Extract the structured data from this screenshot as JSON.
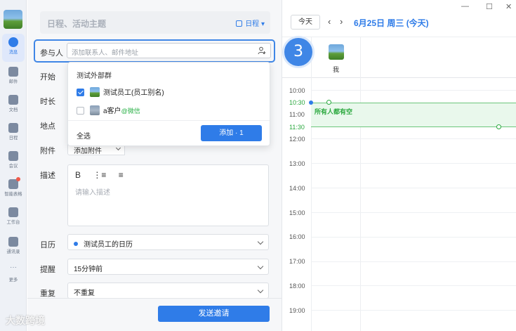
{
  "rail": {
    "items": [
      {
        "label": "消息",
        "icon": "chat-icon"
      },
      {
        "label": "邮件",
        "icon": "mail-icon"
      },
      {
        "label": "文档",
        "icon": "doc-icon"
      },
      {
        "label": "日程",
        "icon": "calendar-icon"
      },
      {
        "label": "会议",
        "icon": "meeting-icon"
      },
      {
        "label": "智能表格",
        "icon": "smart-sheet-icon"
      },
      {
        "label": "工作台",
        "icon": "workbench-icon"
      },
      {
        "label": "通讯录",
        "icon": "contacts-icon"
      },
      {
        "label": "更多",
        "icon": "more-icon"
      }
    ]
  },
  "form": {
    "title_placeholder": "日程、活动主题",
    "calendar_tag": "日程",
    "attendees_label": "参与人",
    "attendees_placeholder": "添加联系人、邮件地址",
    "start_label": "开始",
    "duration_label": "时长",
    "location_label": "地点",
    "attachment_label": "附件",
    "attachment_button": "添加附件",
    "description_label": "描述",
    "description_tools": [
      "B",
      "⋮≡",
      "≡"
    ],
    "description_placeholder": "请输入描述",
    "calendar_label": "日历",
    "calendar_value": "测试员工的日历",
    "reminder_label": "提醒",
    "reminder_value": "15分钟前",
    "repeat_label": "重复",
    "repeat_value": "不重复",
    "send_button": "发送邀请"
  },
  "dropdown": {
    "group": "测试外部群",
    "items": [
      {
        "name": "测试员工(员工别名)",
        "checked": true,
        "tag": ""
      },
      {
        "name": "a客户",
        "checked": false,
        "tag": "@微信"
      }
    ],
    "select_all": "全选",
    "add_button": "添加 · 1"
  },
  "badge": "3",
  "calendar": {
    "today_button": "今天",
    "date_title": "6月25日 周三 (今天)",
    "participant": "我",
    "hours": [
      "10:00",
      "10:30",
      "11:00",
      "11:30",
      "12:00",
      "13:00",
      "14:00",
      "15:00",
      "16:00",
      "17:00",
      "18:00",
      "19:00"
    ],
    "free_text": "所有人都有空"
  },
  "window": {
    "minimize": "—",
    "maximize": "☐",
    "close": "✕"
  },
  "watermark": "大数跨境"
}
